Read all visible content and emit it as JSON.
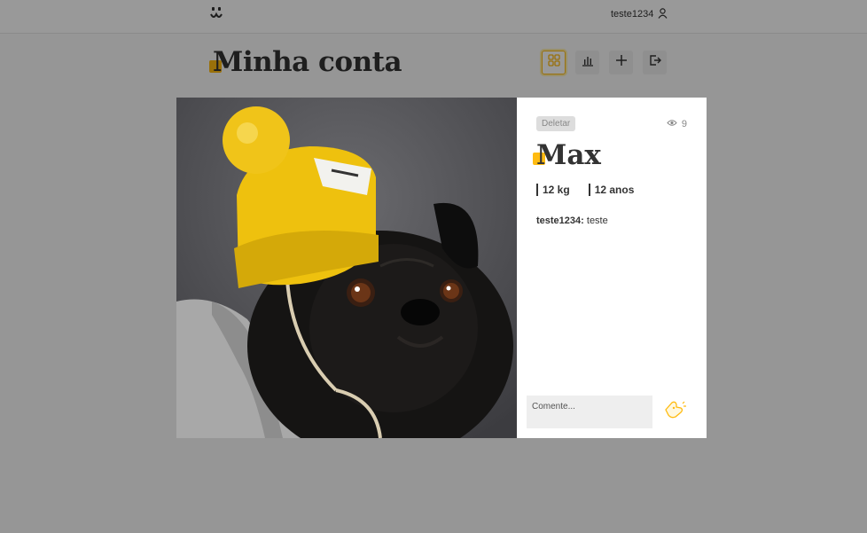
{
  "header": {
    "logo_icon": "dog-face-icon",
    "username": "teste1234",
    "user_icon": "user-icon"
  },
  "page": {
    "title": "Minha conta",
    "accent_color": "#ffbb11"
  },
  "nav": {
    "items": [
      {
        "icon": "feed-grid-icon",
        "active": true
      },
      {
        "icon": "stats-chart-icon",
        "active": false
      },
      {
        "icon": "plus-icon",
        "active": false
      },
      {
        "icon": "logout-icon",
        "active": false
      }
    ]
  },
  "modal": {
    "photo": "pug-in-yellow-beanie-photo",
    "delete_label": "Deletar",
    "views": "9",
    "views_icon": "eye-icon",
    "pet_name": "Max",
    "attributes": [
      "12 kg",
      "12 anos"
    ],
    "comments": [
      {
        "author": "teste1234:",
        "text": " teste"
      }
    ],
    "comment_placeholder": "Comente...",
    "send_icon": "dog-send-icon"
  }
}
